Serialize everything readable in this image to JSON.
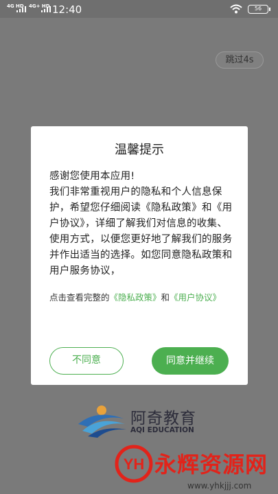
{
  "status_bar": {
    "network1": "4G HD",
    "network2": "4G+ HD",
    "time": "12:40",
    "battery": "56"
  },
  "skip_button": "跳过4s",
  "dialog": {
    "title": "温馨提示",
    "body": "感谢您使用本应用!\n我们非常重视用户的隐私和个人信息保护，希望您仔细阅读《隐私政策》和《用户协议》，详细了解我们对信息的收集、使用方式，以便您更好地了解我们的服务并作出适当的选择。如您同意隐私政策和用户服务协议，",
    "links_prefix": "点击查看完整的",
    "privacy_link": "《隐私政策》",
    "links_and": "和",
    "user_link": "《用户协议》",
    "disagree_label": "不同意",
    "agree_label": "同意并继续"
  },
  "logo": {
    "name": "阿奇教育",
    "english": "AQI EDUCATION"
  },
  "watermark": {
    "text": "永辉资源网",
    "url": "www.yhkjjj.com"
  },
  "colors": {
    "accent": "#4caf50",
    "overlay": "#7a7a7a",
    "watermark": "#e2231a"
  }
}
